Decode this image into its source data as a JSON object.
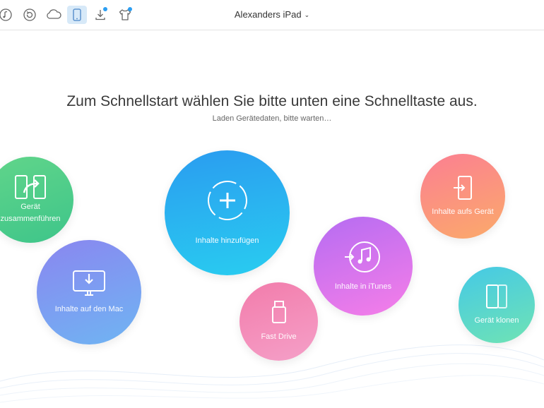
{
  "toolbar": {
    "icons": [
      "music-icon",
      "backup-icon",
      "cloud-icon",
      "device-icon",
      "download-icon",
      "shirt-icon"
    ],
    "device_name": "Alexanders iPad"
  },
  "main": {
    "headline": "Zum Schnellstart wählen Sie bitte unten eine Schnelltaste aus.",
    "status": "Laden Gerätedaten, bitte warten…"
  },
  "quick_buttons": {
    "merge": {
      "label_line1": "Gerät",
      "label_line2": "zusammenführen"
    },
    "mac": {
      "label": "Inhalte auf den Mac"
    },
    "add": {
      "label": "Inhalte hinzufügen"
    },
    "drive": {
      "label": "Fast Drive"
    },
    "itunes": {
      "label": "Inhalte in iTunes"
    },
    "device": {
      "label": "Inhalte aufs Gerät"
    },
    "clone": {
      "label": "Gerät klonen"
    }
  },
  "colors": {
    "accent": "#2b9ef2",
    "merge": "#4ccb8a",
    "mac": "#7b9ef2",
    "add": "#29b4f0",
    "drive": "#f48bb8",
    "itunes": "#d676ee",
    "device": "#fb9580",
    "clone": "#55d4cc"
  }
}
